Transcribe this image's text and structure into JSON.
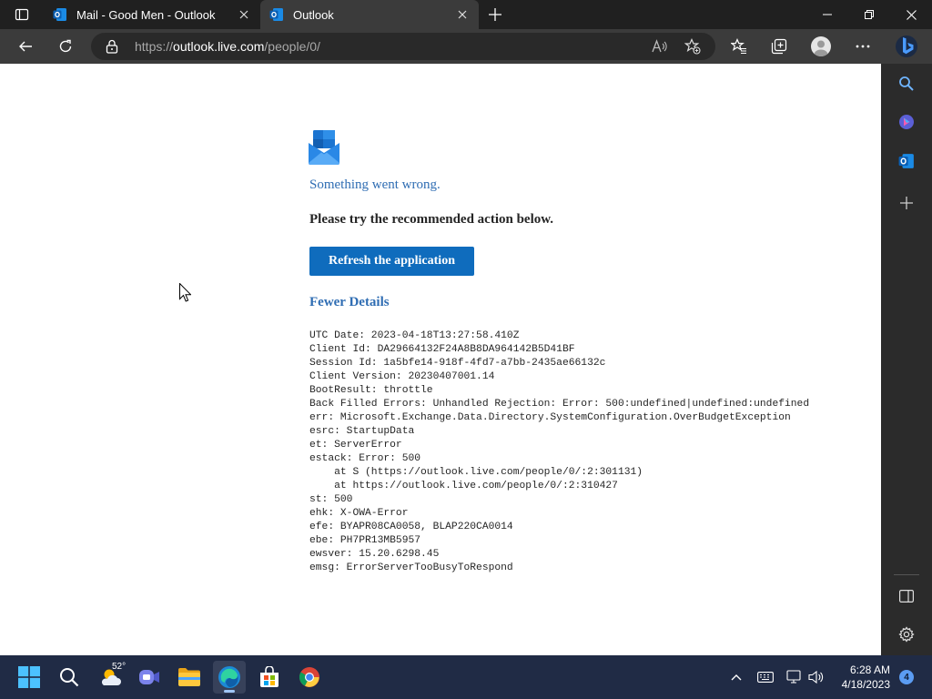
{
  "browser": {
    "tabs": [
      {
        "title": "Mail - Good Men - Outlook",
        "active": false,
        "icon": "outlook-icon"
      },
      {
        "title": "Outlook",
        "active": true,
        "icon": "outlook-icon"
      }
    ],
    "url_prefix": "https://",
    "url_host": "outlook.live.com",
    "url_path": "/people/0/"
  },
  "error_page": {
    "title": "Something went wrong.",
    "subtitle": "Please try the recommended action below.",
    "refresh_label": "Refresh the application",
    "details_toggle": "Fewer Details",
    "details_lines": [
      "UTC Date: 2023-04-18T13:27:58.410Z",
      "Client Id: DA29664132F24A8B8DA964142B5D41BF",
      "Session Id: 1a5bfe14-918f-4fd7-a7bb-2435ae66132c",
      "Client Version: 20230407001.14",
      "BootResult: throttle",
      "Back Filled Errors: Unhandled Rejection: Error: 500:undefined|undefined:undefined",
      "err: Microsoft.Exchange.Data.Directory.SystemConfiguration.OverBudgetException",
      "esrc: StartupData",
      "et: ServerError",
      "estack: Error: 500",
      "    at S (https://outlook.live.com/people/0/:2:301131)",
      "    at https://outlook.live.com/people/0/:2:310427",
      "st: 500",
      "ehk: X-OWA-Error",
      "efe: BYAPR08CA0058, BLAP220CA0014",
      "ebe: PH7PR13MB5957",
      "ewsver: 15.20.6298.45",
      "emsg: ErrorServerTooBusyToRespond"
    ]
  },
  "taskbar": {
    "weather_temp": "52°",
    "time": "6:28 AM",
    "date": "4/18/2023",
    "notification_count": "4"
  },
  "colors": {
    "accent": "#0f6cbd",
    "error_title": "#2f6db3",
    "taskbar": "#202b45"
  }
}
